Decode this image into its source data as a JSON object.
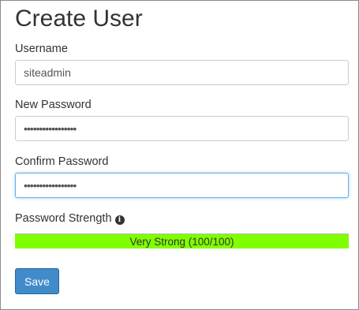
{
  "form": {
    "title": "Create User",
    "username": {
      "label": "Username",
      "value": "siteadmin"
    },
    "new_password": {
      "label": "New Password",
      "value": "•••••••••••••••••"
    },
    "confirm_password": {
      "label": "Confirm Password",
      "value": "•••••••••••••••••"
    },
    "strength": {
      "label": "Password Strength",
      "info_icon": "info-circle-icon",
      "text": "Very Strong (100/100)",
      "score": 100,
      "max": 100,
      "color": "#80ff00"
    },
    "save_label": "Save"
  },
  "colors": {
    "primary": "#428bca",
    "focus": "#66afe9",
    "strength_fill": "#80ff00"
  }
}
